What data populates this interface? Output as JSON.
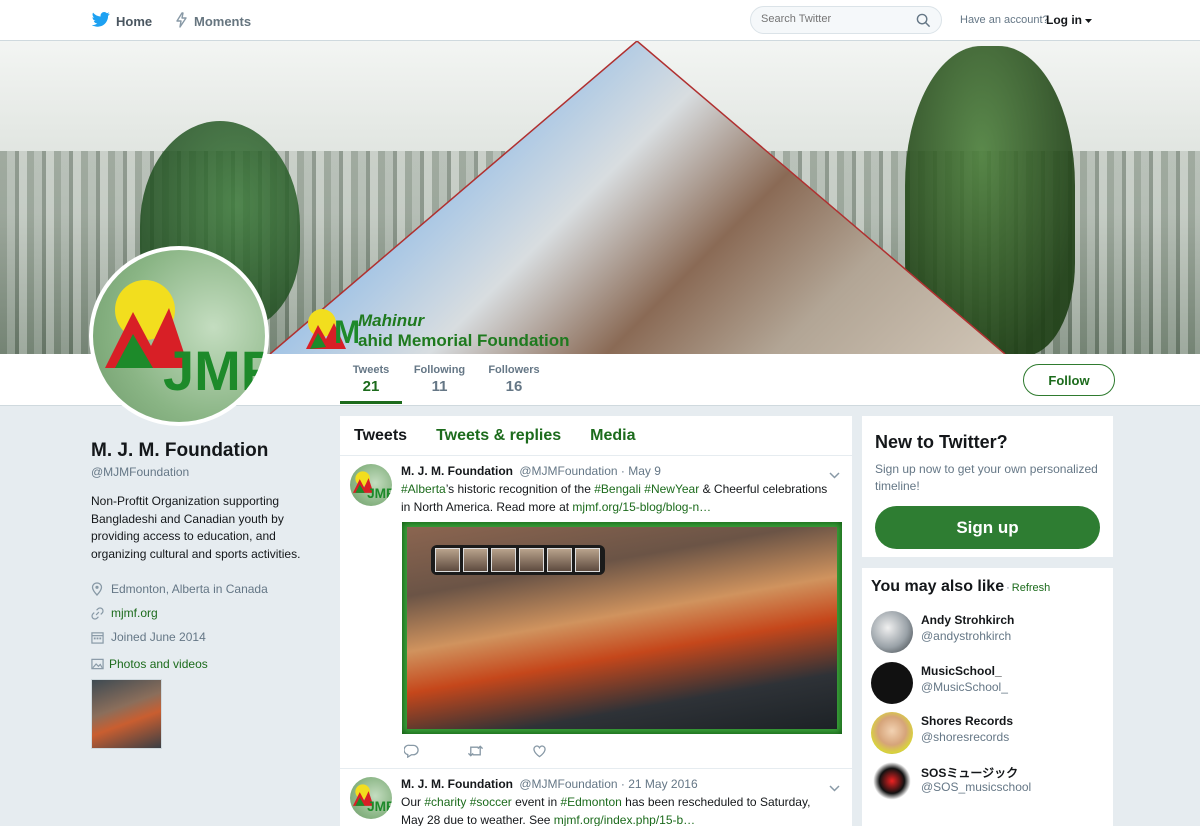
{
  "nav": {
    "home_label": "Home",
    "moments_label": "Moments",
    "search_placeholder": "Search Twitter",
    "have_account": "Have an account?",
    "login_label": "Log in"
  },
  "banner": {
    "logo_line1": "Mahinur",
    "logo_line2": "ahid Memorial Foundation",
    "logo_mark": "MJ",
    "avatar_mark": "JMF"
  },
  "stats": {
    "tweets_label": "Tweets",
    "tweets_value": "21",
    "following_label": "Following",
    "following_value": "11",
    "followers_label": "Followers",
    "followers_value": "16",
    "follow_button": "Follow"
  },
  "profile": {
    "name": "M. J. M. Foundation",
    "handle": "@MJMFoundation",
    "bio": "Non-Proftit Organization supporting Bangladeshi and Canadian youth by providing access to education, and organizing cultural and sports activities.",
    "location": "Edmonton, Alberta in Canada",
    "website": "mjmf.org",
    "joined": "Joined June 2014",
    "photos_label": "Photos and videos"
  },
  "tabs": [
    "Tweets",
    "Tweets & replies",
    "Media"
  ],
  "tweets": [
    {
      "name": "M. J. M. Foundation",
      "handle": "@MJMFoundation",
      "date": "· May 9",
      "text_parts": [
        "#Alberta",
        "’s historic recognition of the ",
        "#Bengali",
        " ",
        "#NewYear",
        " & Cheerful celebrations in North America. Read more at ",
        "mjmf.org/15-blog/blog-n…"
      ]
    },
    {
      "name": "M. J. M. Foundation",
      "handle": "@MJMFoundation",
      "date": "· 21 May 2016",
      "text_parts": [
        "Our ",
        "#charity",
        " ",
        "#soccer",
        " event in ",
        "#Edmonton",
        " has been rescheduled to Saturday, May 28 due to weather. See ",
        "mjmf.org/index.php/15-b…"
      ]
    }
  ],
  "signup_box": {
    "title": "New to Twitter?",
    "text": "Sign up now to get your own personalized timeline!",
    "button": "Sign up"
  },
  "suggestions": {
    "title": "You may also like",
    "dot": "·",
    "refresh": "Refresh",
    "items": [
      {
        "name": "Andy Strohkirch",
        "handle": "@andystrohkirch"
      },
      {
        "name": "MusicSchool_",
        "handle": "@MusicSchool_"
      },
      {
        "name": "Shores Records",
        "handle": "@shoresrecords"
      },
      {
        "name": "SOSミュージック",
        "handle": "@SOS_musicschool"
      }
    ]
  },
  "colors": {
    "accent": "#1c6b1c",
    "signup": "#2e7d32",
    "page_bg": "#e6ecf0"
  }
}
